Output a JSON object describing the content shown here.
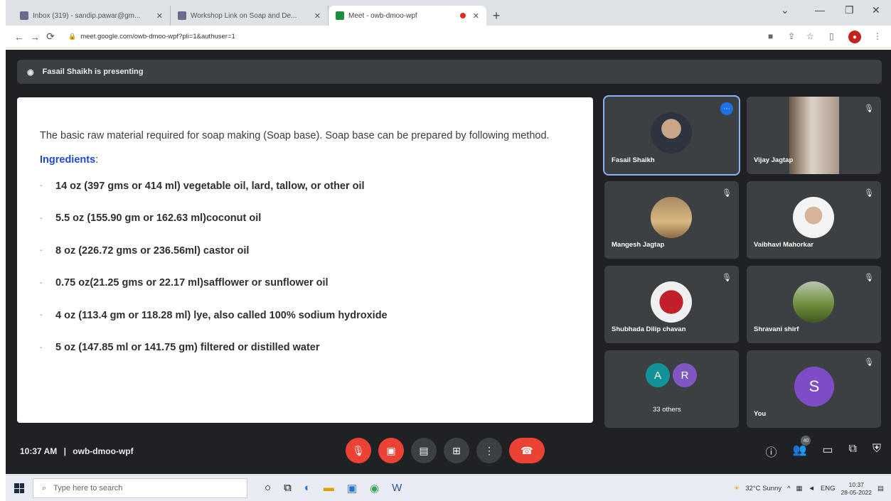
{
  "browser": {
    "tabs": [
      {
        "label": "Inbox (319) - sandip.pawar@gm...",
        "active": false
      },
      {
        "label": "Workshop Link on Soap and De...",
        "active": false
      },
      {
        "label": "Meet - owb-dmoo-wpf",
        "active": true
      }
    ],
    "url": "meet.google.com/owb-dmoo-wpf?pli=1&authuser=1"
  },
  "meet": {
    "presenting_text": "Fasail Shaikh is presenting",
    "slide": {
      "intro": "The basic raw material required for soap making (Soap base). Soap base can be prepared by following method.",
      "ingredients_heading": "Ingredients",
      "ingredients_colon": ":",
      "items": [
        "14 oz (397 gms or 414 ml) vegetable oil, lard, tallow, or other oil",
        "5.5 oz (155.90 gm or 162.63 ml)coconut oil",
        "8 oz (226.72 gms or 236.56ml) castor oil",
        "0.75 oz(21.25 gms  or 22.17 ml)safflower or sunflower oil",
        "4 oz  (113.4 gm or 118.28 ml) lye, also called 100% sodium hydroxide",
        "5 oz (147.85 ml or 141.75 gm) filtered or distilled water"
      ]
    },
    "participants": [
      {
        "name": "Fasail Shaikh"
      },
      {
        "name": "Vijay Jagtap"
      },
      {
        "name": "Mangesh Jagtap"
      },
      {
        "name": "Vaibhavi Mahorkar"
      },
      {
        "name": "Shubhada Dilip chavan"
      },
      {
        "name": "Shravani shirf"
      }
    ],
    "others": {
      "initials": [
        "A",
        "R"
      ],
      "label": "33 others"
    },
    "you": {
      "initial": "S",
      "label": "You"
    },
    "time": "10:37 AM",
    "separator": "|",
    "meeting_code": "owb-dmoo-wpf",
    "people_count": "40"
  },
  "taskbar": {
    "search_placeholder": "Type here to search",
    "weather": "32°C Sunny",
    "lang": "ENG",
    "clock_time": "10:37",
    "clock_date": "28-05-2022"
  },
  "colors": {
    "meet_bg": "#202124",
    "tile_bg": "#3c4043",
    "end_call": "#ea4335",
    "ingredients_heading": "#2348d6"
  }
}
